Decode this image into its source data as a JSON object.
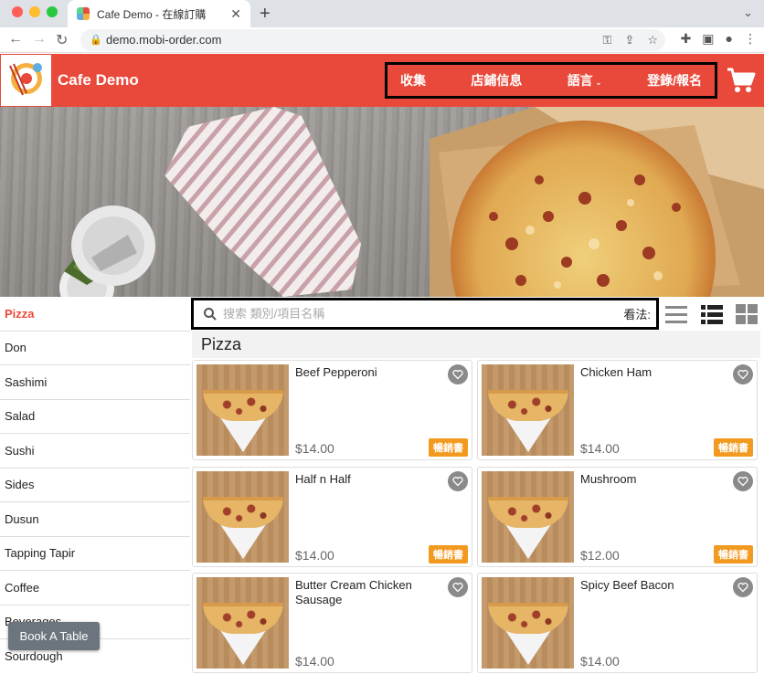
{
  "browser": {
    "tab_title": "Cafe Demo - 在線訂購",
    "url": "demo.mobi-order.com"
  },
  "site": {
    "brand": "Cafe Demo",
    "nav": {
      "collect": "收集",
      "store_info": "店鋪信息",
      "language": "語言",
      "login": "登錄/報名"
    }
  },
  "sidebar": {
    "items": [
      {
        "label": "Pizza",
        "active": true
      },
      {
        "label": "Don"
      },
      {
        "label": "Sashimi"
      },
      {
        "label": "Salad"
      },
      {
        "label": "Sushi"
      },
      {
        "label": "Sides"
      },
      {
        "label": "Dusun"
      },
      {
        "label": "Tapping Tapir"
      },
      {
        "label": "Coffee"
      },
      {
        "label": "Beverages"
      },
      {
        "label": "Sourdough"
      }
    ],
    "book_table": "Book A Table"
  },
  "search": {
    "placeholder": "搜索 類別/項目名稱",
    "view_label": "看法:"
  },
  "section": {
    "title": "Pizza"
  },
  "products": [
    {
      "name": "Beef Pepperoni",
      "price": "$14.00",
      "badge": "暢銷書"
    },
    {
      "name": "Chicken Ham",
      "price": "$14.00",
      "badge": "暢銷書"
    },
    {
      "name": "Half n Half",
      "price": "$14.00",
      "badge": "暢銷書"
    },
    {
      "name": "Mushroom",
      "price": "$12.00",
      "badge": "暢銷書"
    },
    {
      "name": "Butter Cream Chicken Sausage",
      "price": "$14.00",
      "badge": ""
    },
    {
      "name": "Spicy Beef Bacon",
      "price": "$14.00",
      "badge": ""
    }
  ],
  "colors": {
    "brand_red": "#e9493b",
    "badge_orange": "#f29a1f"
  }
}
